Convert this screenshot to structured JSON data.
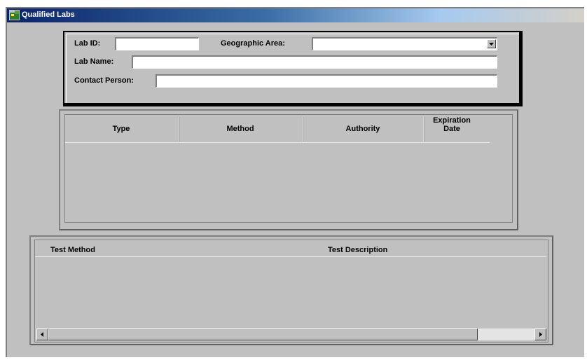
{
  "window": {
    "title": "Qualified Labs"
  },
  "form": {
    "lab_id_label": "Lab ID:",
    "lab_id_value": "",
    "geo_area_label": "Geographic Area:",
    "geo_area_value": "",
    "lab_name_label": "Lab Name:",
    "lab_name_value": "",
    "contact_label": "Contact Person:",
    "contact_value": ""
  },
  "qualifications_table": {
    "columns": [
      "Type",
      "Method",
      "Authority",
      "Expiration Date"
    ],
    "rows": []
  },
  "tests_table": {
    "columns": [
      "Test Method",
      "Test Description"
    ],
    "rows": []
  },
  "icons": {
    "window": "app-window-icon",
    "dropdown": "chevron-down-icon",
    "scroll_left": "arrow-left-icon",
    "scroll_right": "arrow-right-icon"
  }
}
